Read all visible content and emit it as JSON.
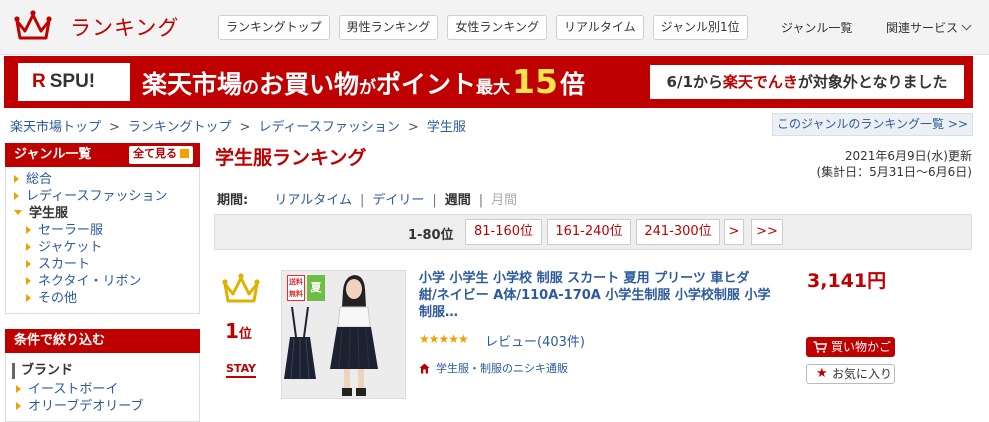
{
  "header": {
    "brand": "ランキング",
    "nav": [
      "ランキングトップ",
      "男性ランキング",
      "女性ランキング",
      "リアルタイム",
      "ジャンル別1位"
    ],
    "genre_list": "ジャンル一覧",
    "related": "関連サービス"
  },
  "banner": {
    "spu": "SPU!",
    "spu_r": "R",
    "promo_a": "楽天市場",
    "promo_b": "の",
    "promo_c": "お買い物",
    "promo_d": "が",
    "promo_e": "ポイント",
    "promo_f": "最大",
    "promo_g": "15",
    "promo_h": "倍",
    "notice_a": "6/1から",
    "notice_b": "楽天でんき",
    "notice_c": "が対象外となりました"
  },
  "breadcrumb": [
    "楽天市場トップ",
    "ランキングトップ",
    "レディースファッション",
    "学生服"
  ],
  "genre_ranking_link": "このジャンルのランキング一覧 >>",
  "sidebar": {
    "genre_title": "ジャンル一覧",
    "see_all": "全て見る",
    "items": [
      {
        "label": "総合"
      },
      {
        "label": "レディースファッション"
      },
      {
        "label": "学生服"
      },
      {
        "label": "セーラー服"
      },
      {
        "label": "ジャケット"
      },
      {
        "label": "スカート"
      },
      {
        "label": "ネクタイ・リボン"
      },
      {
        "label": "その他"
      }
    ],
    "filter_title": "条件で絞り込む",
    "brand_title": "ブランド",
    "brands": [
      "イーストボーイ",
      "オリーブデオリーブ"
    ]
  },
  "main": {
    "title": "学生服ランキング",
    "updated": "2021年6月9日(水)更新",
    "period_range": "(集計日：5月31日～6月6日)",
    "period_label": "期間:",
    "periods": [
      "リアルタイム",
      "デイリー",
      "週間",
      "月間"
    ],
    "pager": {
      "current": "1-80位",
      "pages": [
        "81-160位",
        "161-240位",
        "241-300位",
        ">",
        ">>"
      ]
    }
  },
  "item": {
    "rank": "1",
    "rank_suffix": "位",
    "status": "STAY",
    "badge_ship": "送料無料",
    "badge_summer": "夏",
    "title": "小学 小学生 小学校 制服 スカート 夏用 プリーツ 車ヒダ 紺/ネイビー A体/110A-170A 小学生制服 小学校制服 小学制服…",
    "stars": "★★★★★",
    "rating": 4.5,
    "review": "レビュー(403件)",
    "shop": "学生服・制服のニシキ通販",
    "price": "3,141円",
    "cart": "買い物かご",
    "favorite": "お気に入り"
  },
  "colors": {
    "brand_red": "#bf0000",
    "link_blue": "#2c5a9c",
    "accent_orange": "#f0a000",
    "promo_yellow": "#ffe34d"
  }
}
